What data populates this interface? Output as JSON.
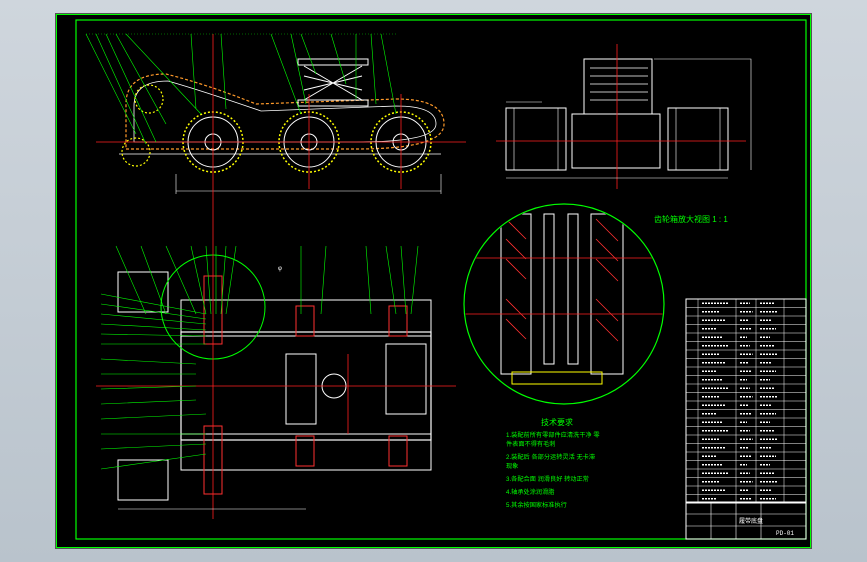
{
  "drawing": {
    "detail_title": "齿轮箱放大视图 1 : 1",
    "dimension_hint": "φ",
    "tech_requirements": {
      "title": "技术要求",
      "lines": [
        "1.装配前所有零部件应清洗干净 零",
        "  件表面不得有毛刺",
        "2.装配后 各部分运转灵活 无卡滞",
        "  现象",
        "3.各配合面 润滑良好 转动正常",
        "4.轴承处涂润滑脂",
        "5.其余按国家标准执行"
      ]
    },
    "title_block": {
      "name": "履带底盘",
      "drawing_no": "PD-01"
    }
  },
  "colors": {
    "background": "#000000",
    "frame": "#00ff00",
    "part": "#ffffff",
    "centerline": "#ff2020",
    "hatch": "#ff3030",
    "accent": "#ffff00",
    "leader": "#00ff00"
  }
}
